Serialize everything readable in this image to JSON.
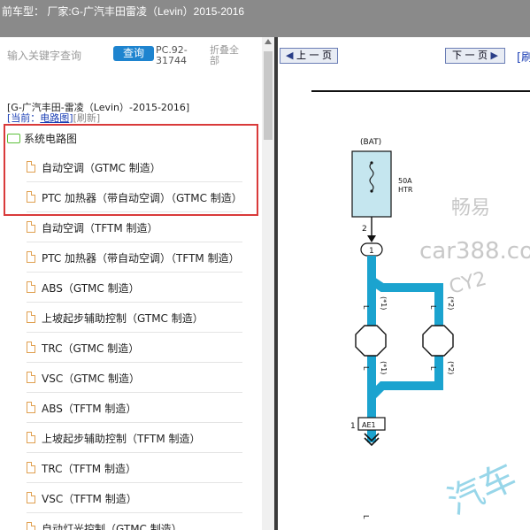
{
  "title": "前车型： 厂家:G-广汽丰田雷凌（Levin）2015-2016",
  "search": {
    "placeholder": "输入关键字查询",
    "button": "查询",
    "code": "PC.92-31744",
    "collapse": "折叠全部"
  },
  "model": "[G-广汽丰田-雷凌（Levin）-2015-2016]",
  "current": {
    "prefix": "[当前：",
    "name": "电路图",
    "suffix": "]",
    "refresh": "[刷新]"
  },
  "tree": {
    "root": "系统电路图",
    "items": [
      "自动空调（GTMC 制造）",
      "PTC 加热器（带自动空调）（GTMC 制造）",
      "自动空调（TFTM 制造）",
      "PTC 加热器（带自动空调）（TFTM 制造）",
      "ABS（GTMC 制造）",
      "上坡起步辅助控制（GTMC 制造）",
      "TRC（GTMC 制造）",
      "VSC（GTMC 制造）",
      "ABS（TFTM 制造）",
      "上坡起步辅助控制（TFTM 制造）",
      "TRC（TFTM 制造）",
      "VSC（TFTM 制造）",
      "自动灯光控制（GTMC 制造）"
    ]
  },
  "nav": {
    "prev": "上 一 页",
    "next": "下 一 页",
    "tail": "[刷"
  },
  "diagram": {
    "bat": "(BAT)",
    "fuse_amp": "50A",
    "fuse_name": "HTR",
    "pin2": "2",
    "pin1": "1",
    "conn1": "1",
    "connector": "AE1",
    "connector_pin": "1",
    "wire_color": "L",
    "variant1": "(*1)",
    "variant2": "(*2)"
  },
  "watermark": {
    "site": "car388.co",
    "brand": "畅易",
    "code": "CY2",
    "extra": "汽车"
  },
  "colors": {
    "wire": "#1ba3cf",
    "fuse_box": "#c5e6ef",
    "highlight": "#d93a3a"
  }
}
